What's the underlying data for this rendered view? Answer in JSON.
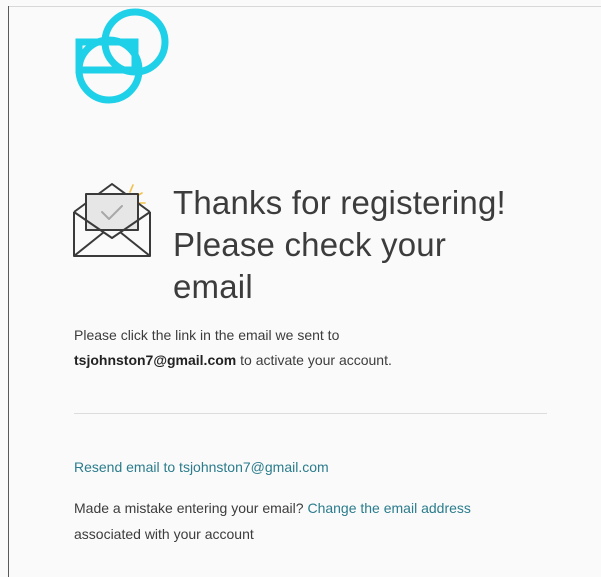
{
  "brand": {
    "logo_icon": "gemini-logo-icon",
    "accent_color": "#1fd1e8",
    "link_color": "#2b7c8c"
  },
  "hero": {
    "icon": "envelope-check-icon",
    "heading_line1": "Thanks for registering!",
    "heading_line2": "Please check your",
    "heading_line3": "email"
  },
  "message": {
    "line1": "Please click the link in the email we sent to",
    "email": "tsjohnston7@gmail.com",
    "line2_suffix": " to activate your account."
  },
  "actions": {
    "resend_label": "Resend email to tsjohnston7@gmail.com",
    "mistake_prefix": "Made a mistake entering your email? ",
    "change_email_label": "Change the email address",
    "mistake_suffix": "associated with your account"
  }
}
